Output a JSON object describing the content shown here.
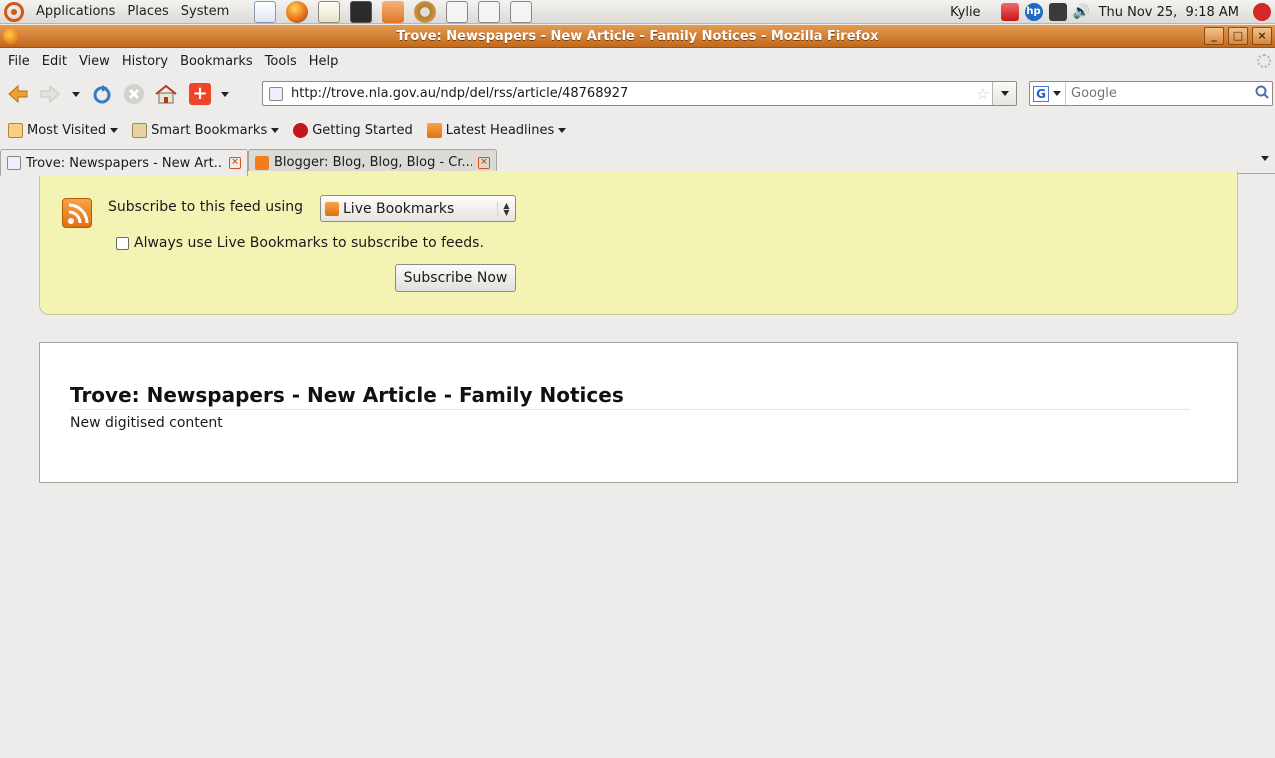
{
  "panel": {
    "menus": [
      "Applications",
      "Places",
      "System"
    ],
    "user": "Kylie",
    "clock": "Thu Nov 25,  9:18 AM"
  },
  "window": {
    "title": "Trove: Newspapers - New Article - Family Notices - Mozilla Firefox"
  },
  "menubar": {
    "items": [
      {
        "label": "File"
      },
      {
        "label": "Edit"
      },
      {
        "label": "View"
      },
      {
        "label": "History"
      },
      {
        "label": "Bookmarks"
      },
      {
        "label": "Tools"
      },
      {
        "label": "Help"
      }
    ]
  },
  "navbar": {
    "url": "http://trove.nla.gov.au/ndp/del/rss/article/48768927",
    "search_placeholder": "Google"
  },
  "bookmarks": {
    "items": [
      {
        "label": "Most Visited",
        "icon": "most-visited-icon"
      },
      {
        "label": "Smart Bookmarks",
        "icon": "folder-icon"
      },
      {
        "label": "Getting Started",
        "icon": "firefox-getting-started-icon"
      },
      {
        "label": "Latest Headlines",
        "icon": "rss-icon"
      }
    ]
  },
  "tabs": [
    {
      "label": "Trove: Newspapers - New Art...",
      "active": true
    },
    {
      "label": "Blogger: Blog, Blog, Blog - Cr...",
      "active": false
    }
  ],
  "feed": {
    "subscribe_label": "Subscribe to this feed using",
    "reader_selected": "Live Bookmarks",
    "always_use_label": "Always use Live Bookmarks to subscribe to feeds.",
    "always_use_checked": false,
    "subscribe_button": "Subscribe Now"
  },
  "article": {
    "title": "Trove: Newspapers - New Article - Family Notices",
    "subtitle": "New digitised content"
  },
  "colors": {
    "titlebar": "#d57a2c",
    "feed_bg": "#f3f3b4",
    "rss_orange": "#e0700d"
  }
}
